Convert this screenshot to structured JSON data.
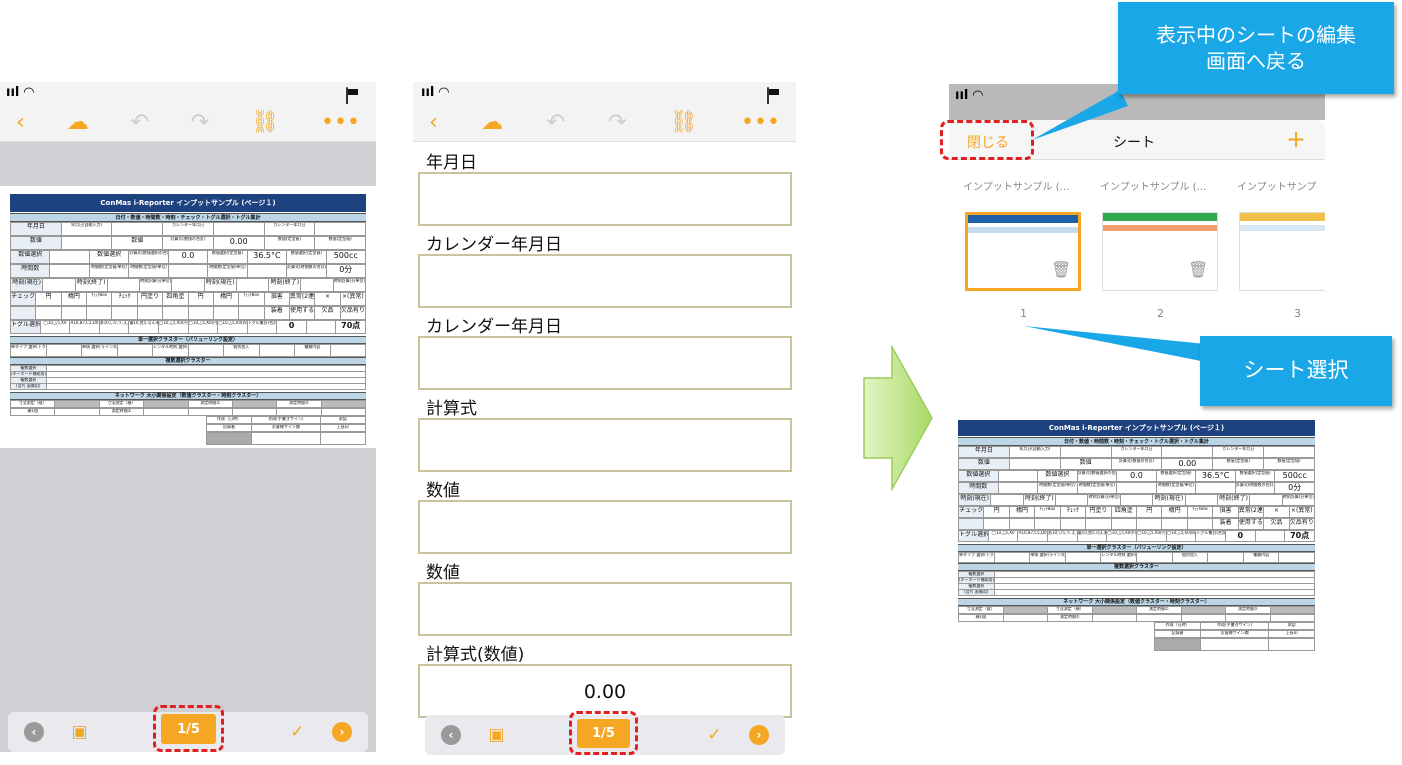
{
  "left_screen": {
    "page_button": "1/5",
    "sheet": {
      "title": "ConMas i-Reporter インプットサンプル (ページ１)",
      "section1": "日付・数値・時間数・時刻・チェック・トグル選択・トグル集計",
      "rows": [
        [
          "年月日",
          "年月日(自動入力)",
          "",
          "カレンダー年月日",
          "",
          "カレンダー年月日",
          ""
        ],
        [
          "数値",
          "",
          "数値",
          "計算式(数値の合計)",
          "0.00",
          "数値(定型値)",
          "数値(定型値)"
        ],
        [
          "数値選択",
          "",
          "数値選択",
          "計算式(数値選択の合計)",
          "0.0",
          "数値選択(定型値)",
          "36.5°C",
          "数値選択(定型値)",
          "500cc"
        ],
        [
          "時間数",
          "",
          "時間数(定型値/単位)",
          "時間数(定型値/単位)",
          "",
          "時間数(定型値/単位)",
          "",
          "計算式(時間数の合計)",
          "0分"
        ],
        [
          "時刻(現在)",
          "",
          "時刻(終了)",
          "",
          "時刻計算(分単位)",
          "",
          "時刻(現在)",
          "",
          "時刻(終了)",
          "",
          "時刻計算(分単位)"
        ],
        [
          "チェック",
          "円",
          "楕円",
          "ﾁｪｯｸBox",
          "ﾁｪｯｸ",
          "円塗り",
          "四角塗",
          "円",
          "楕円",
          "ﾁｪｯｸBox",
          "損害",
          "異常(2連)",
          "×",
          "×(異常)"
        ],
        [
          "",
          "",
          "",
          "",
          "",
          "",
          "",
          "",
          "",
          "",
          "装着",
          "使用する",
          "欠品",
          "欠品有り"
        ],
        [
          "トグル選択",
          "◯10,△5,X0",
          "A10,B7,C5,D0",
          "あ10,い5,う,え,お",
          "優10,良5,可3,未達-50",
          "◯10,△5,X0(円選,四角塗選択)",
          "◯10,△5,X0(円)",
          "◯10,△5,X0(四角塗)",
          "トグル集計(合計)",
          "0",
          "",
          "70点"
        ]
      ],
      "section2": "単一選択クラスター（バリューリンク設定）",
      "section2_row": [
        "単タイプ 選択(トグル式)",
        "",
        "単項 選択(ライン式)",
        "",
        "レンタル時刻 選択(ロール式)",
        "",
        "個別加入",
        "",
        "種類内容",
        ""
      ],
      "section3": "複数選択クラスター",
      "section3_rows": [
        "複数選択",
        "(キーボード補助用)",
        "複数選択",
        "(音片 画像用)"
      ],
      "section4": "ネットワーク 大小関係設定（数値クラスター・時刻クラスター）",
      "section4_row": [
        "寸法測定（縦）",
        "",
        "寸法測定（横）",
        "",
        "測定時間①",
        "",
        "測定時間②",
        ""
      ],
      "section4_sub": [
        "横1個",
        "",
        "測定時間①",
        "",
        "",
        "",
        "",
        ""
      ],
      "sign_header": [
        "作成（日時）",
        "作成(手書きサイン)",
        "承認"
      ],
      "sign_sub": [
        "記録者",
        "お客様サイン欄",
        "上長印"
      ]
    }
  },
  "middle_screen": {
    "page_button": "1/5",
    "fields": [
      {
        "label": "年月日",
        "value": ""
      },
      {
        "label": "カレンダー年月日",
        "value": ""
      },
      {
        "label": "カレンダー年月日",
        "value": ""
      },
      {
        "label": "計算式",
        "value": ""
      },
      {
        "label": "数値",
        "value": ""
      },
      {
        "label": "数値",
        "value": ""
      },
      {
        "label": "計算式(数値)",
        "value": "0.00"
      }
    ]
  },
  "right_screen": {
    "close_label": "閉じる",
    "title": "シート",
    "add_label": "+",
    "sheet_names": [
      "インプットサンプル (…",
      "インプットサンプル (…",
      "インプットサンプ"
    ],
    "sheet_numbers": [
      "1",
      "2",
      "3"
    ]
  },
  "callouts": {
    "top": "表示中のシートの編集\n画面へ戻る",
    "sheet_select": "シート選択"
  },
  "colors": {
    "accent": "#f5a623",
    "callout": "#1aa7e8",
    "red_dashed": "#e02020",
    "sheet_header": "#1e4280",
    "arrow": "#b9e27a"
  }
}
